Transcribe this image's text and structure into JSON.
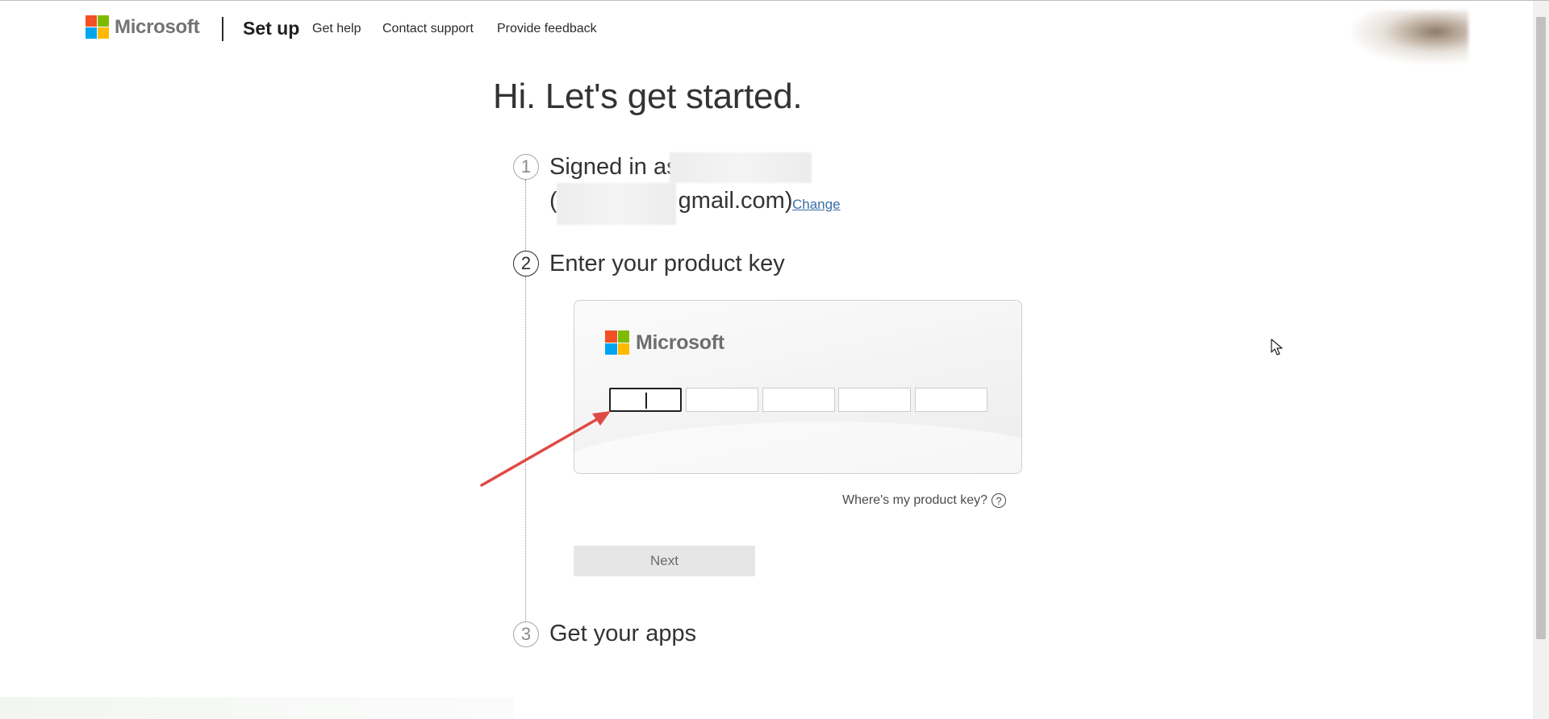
{
  "header": {
    "brand": "Microsoft",
    "title": "Set up",
    "nav": {
      "get_help": "Get help",
      "contact_support": "Contact support",
      "provide_feedback": "Provide feedback"
    }
  },
  "main": {
    "heading": "Hi. Let's get started.",
    "steps": [
      {
        "number": "1",
        "label": "Signed in as"
      },
      {
        "number": "2",
        "label": "Enter your product key"
      },
      {
        "number": "3",
        "label": "Get your apps"
      }
    ],
    "email_suffix": "gmail.com)",
    "email_prefix": "(",
    "change_link": "Change",
    "card": {
      "brand": "Microsoft",
      "key_segments": [
        "",
        "",
        "",
        "",
        ""
      ]
    },
    "where_key": "Where's my product key?",
    "help_glyph": "?",
    "next_button": "Next"
  },
  "colors": {
    "ms_red": "#f25022",
    "ms_green": "#7fba00",
    "ms_blue": "#00a4ef",
    "ms_yellow": "#ffb900",
    "link": "#3a6ea5",
    "annotation_arrow": "#e04a45"
  }
}
